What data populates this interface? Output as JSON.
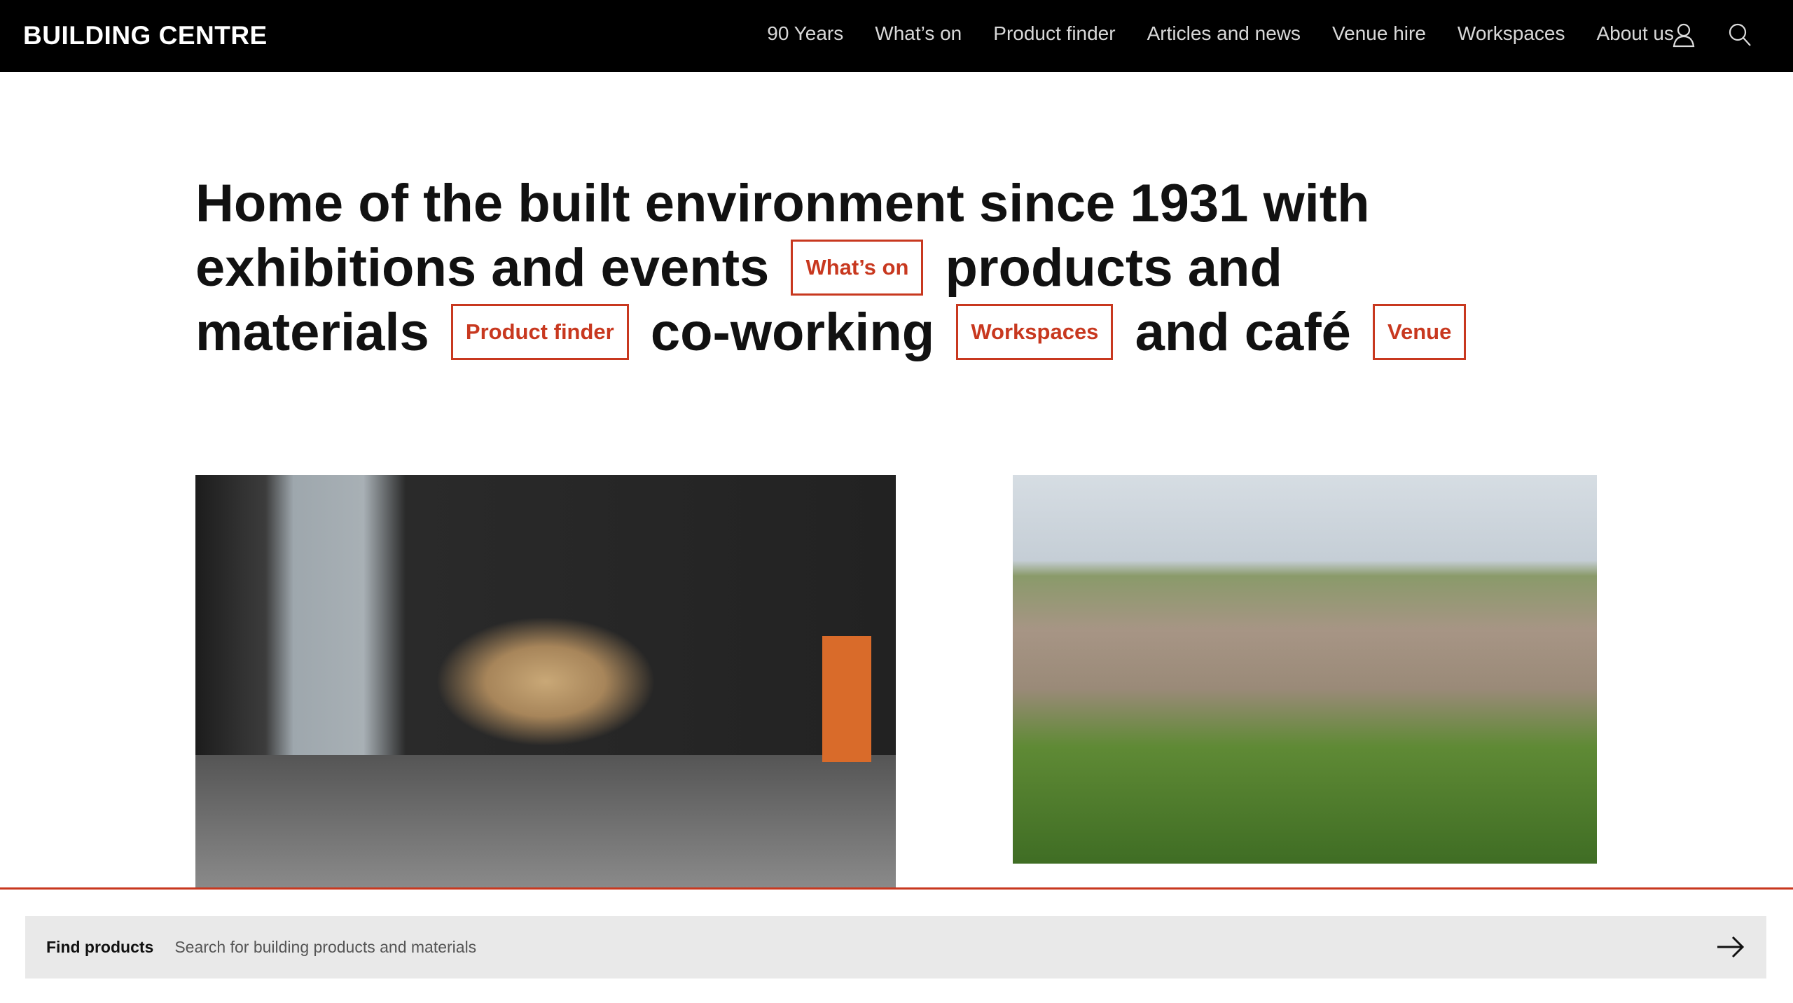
{
  "nav": {
    "logo": "BUILDING CENTRE",
    "items": [
      "90 Years",
      "What’s on",
      "Product finder",
      "Articles and news",
      "Venue hire",
      "Workspaces",
      "About us"
    ],
    "icons": [
      "user-icon",
      "search-icon"
    ]
  },
  "hero": {
    "t1": "Home of the built environment since 1931 with exhibitions and events",
    "tag1": "What’s on",
    "t2": "products and materials",
    "tag2": "Product finder",
    "t3": "co-working",
    "tag3": "Workspaces",
    "t4": "and café",
    "tag4": "Venue"
  },
  "search": {
    "label": "Find products",
    "placeholder": "Search for building products and materials"
  },
  "colors": {
    "accent": "#c8381f",
    "nav_bg": "#000000",
    "search_bg": "#e9e9e9"
  }
}
